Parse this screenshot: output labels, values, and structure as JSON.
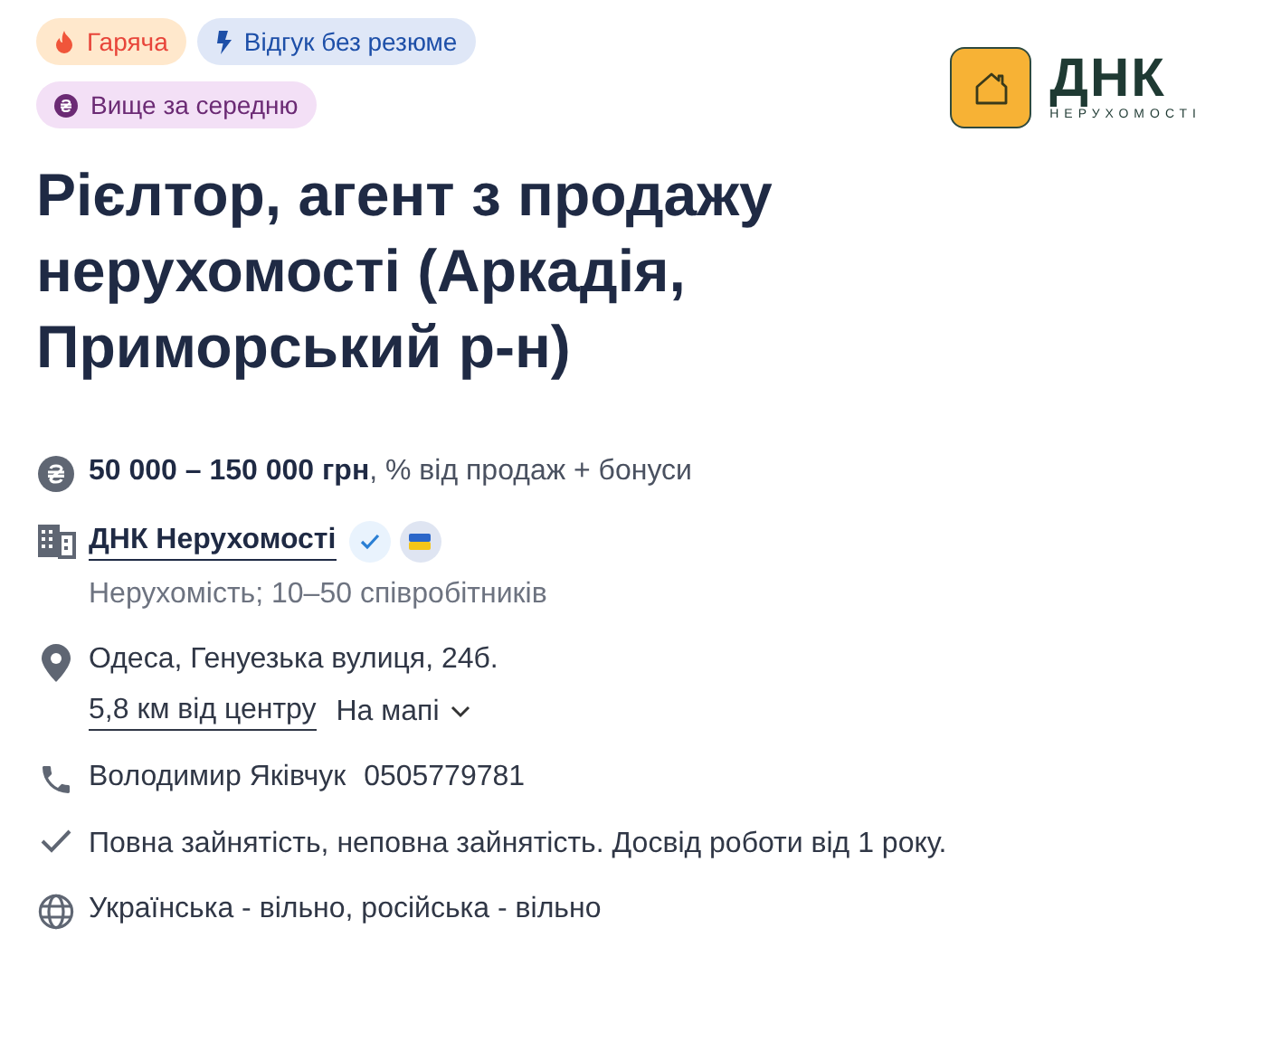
{
  "tags": [
    {
      "kind": "hot",
      "label": "Гаряча"
    },
    {
      "kind": "quick",
      "label": "Відгук без резюме"
    },
    {
      "kind": "salary",
      "label": "Вище за середню"
    }
  ],
  "logo": {
    "name": "ДНК",
    "subtitle": "НЕРУХОМОСТІ"
  },
  "title": "Рієлтор, агент з продажу нерухомості (Аркадія, Приморський р-н)",
  "salary": {
    "amount": "50 000 – 150 000 грн",
    "extra": ", % від продаж + бонуси"
  },
  "company": {
    "name": "ДНК Нерухомості",
    "verified": true,
    "ukrainian": true,
    "info": "Нерухомість; 10–50 співробітників"
  },
  "address": {
    "street": "Одеса, Генуезька вулиця, 24б.",
    "distance": "5,8 км від центру",
    "map_link": "На мапі"
  },
  "contact": {
    "name": "Володимир Яківчук",
    "phone": "0505779781"
  },
  "employment": "Повна зайнятість, неповна зайнятість. Досвід роботи від 1 року.",
  "languages": "Українська - вільно, російська - вільно"
}
